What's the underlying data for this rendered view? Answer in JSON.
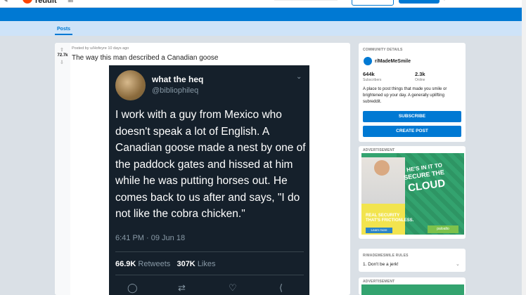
{
  "header": {
    "brand": "reddit",
    "banner_color": "#0079d3"
  },
  "nav": {
    "posts_tab": "Posts"
  },
  "post": {
    "score": "72.7k",
    "meta": "Posted by u/Hofeyre 10 days ago",
    "title": "The way this man described a Canadian goose"
  },
  "tweet": {
    "name": "what the heq",
    "handle": "@bibliophileq",
    "body": "I work with a guy from Mexico who doesn't speak a lot of English. A Canadian goose made a nest by one of the paddock gates and hissed at him while he was putting horses out. He comes back to us after and says, \"I do not like the cobra chicken.\"",
    "time": "6:41 PM · 09 Jun 18",
    "retweets_count": "66.9K",
    "retweets_label": "Retweets",
    "likes_count": "307K",
    "likes_label": "Likes",
    "icons": [
      "reply-icon",
      "retweet-icon",
      "like-icon",
      "share-icon"
    ]
  },
  "community": {
    "header": "COMMUNITY DETAILS",
    "name": "r/MadeMeSmile",
    "subscribers": "644k",
    "subscribers_label": "Subscribers",
    "online": "2.3k",
    "online_label": "Online",
    "description": "A place to post things that made you smile or brightened up your day. A generally uplifting subreddit.",
    "subscribe_label": "SUBSCRIBE",
    "create_post_label": "CREATE POST"
  },
  "advert": {
    "label": "ADVERTISEMENT",
    "headline1": "HE'S IN IT TO",
    "headline2": "SECURE THE",
    "headline3": "CLOUD",
    "tagline1": "REAL SECURITY",
    "tagline2": "THAT'S FRICTIONLESS.",
    "learn_more": "Learn more",
    "sponsor": "paloalto"
  },
  "rules": {
    "header": "R/MADEMESMILE RULES",
    "items": [
      "1. Don't be a jerk!"
    ]
  },
  "advert2": {
    "label": "ADVERTISEMENT"
  }
}
